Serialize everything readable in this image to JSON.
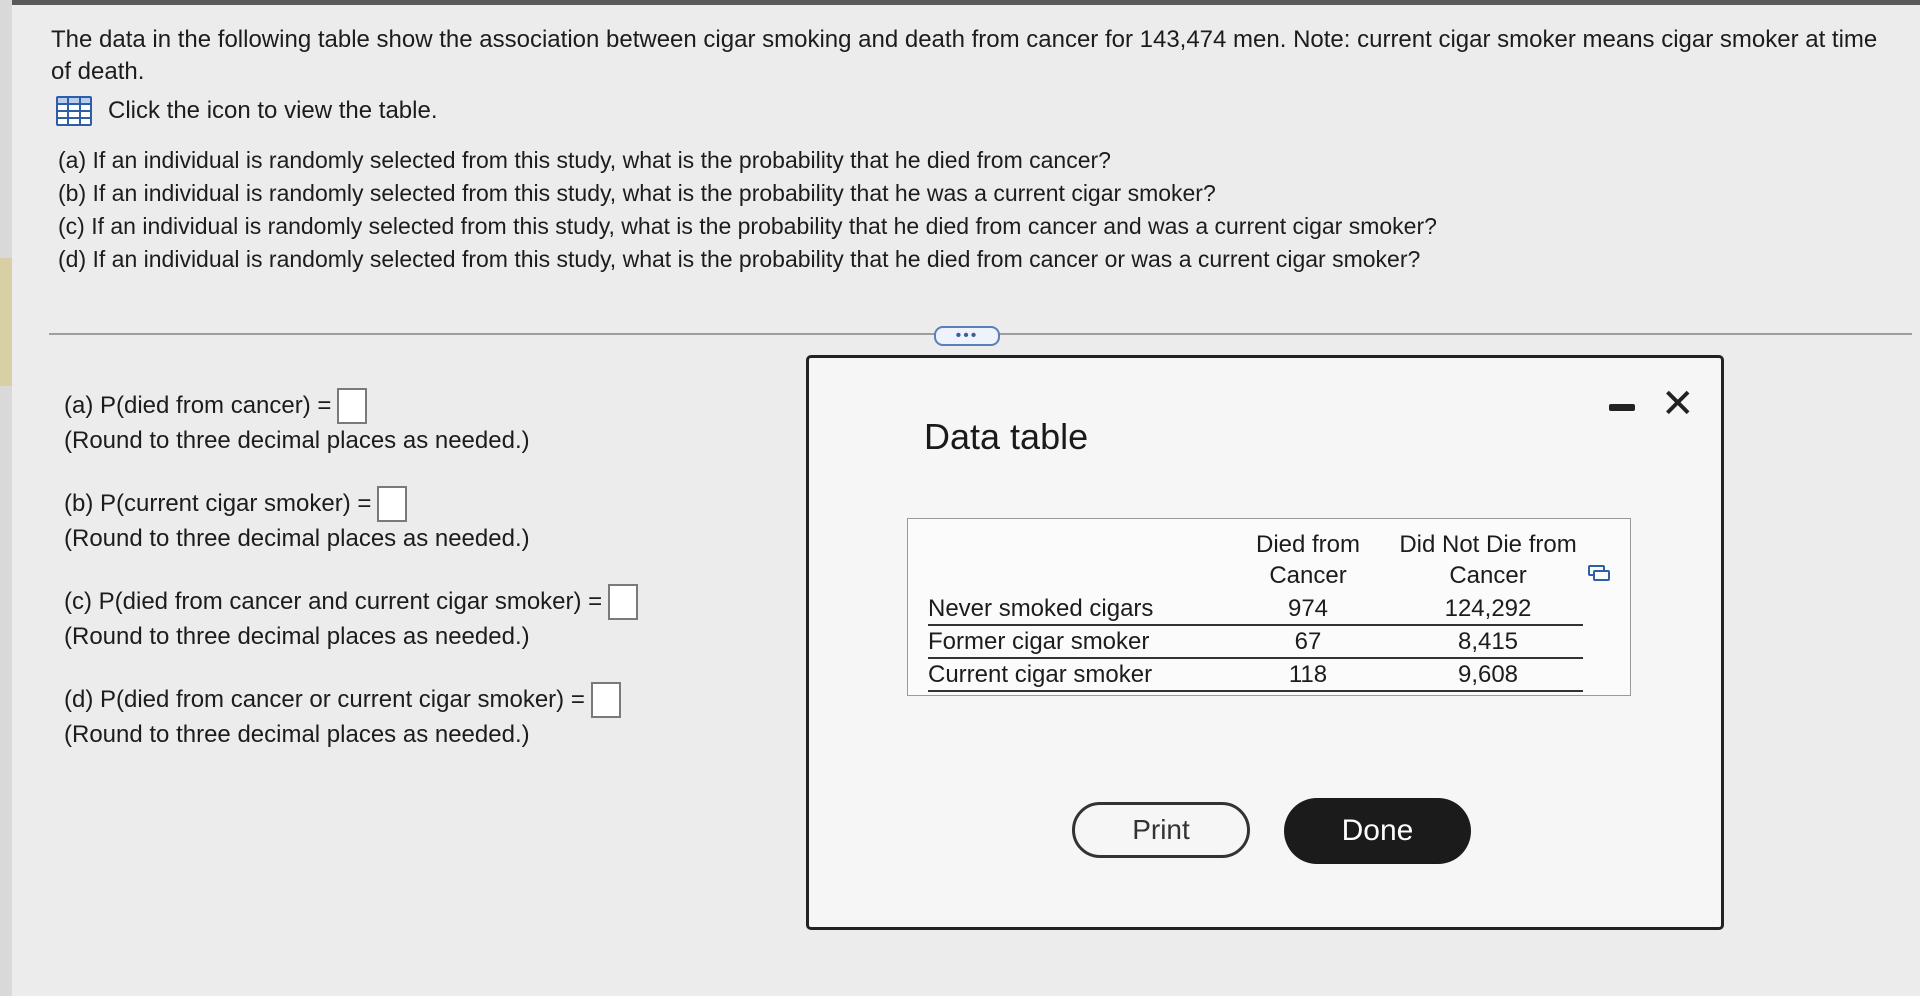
{
  "question": {
    "intro": "The data in the following table show the association between cigar smoking and death from cancer for 143,474 men. Note: current cigar smoker means cigar smoker at time of death.",
    "table_link": "Click the icon to view the table.",
    "parts": [
      "(a) If an individual is randomly selected from this study, what is the probability that he died from cancer?",
      "(b) If an individual is randomly selected from this study, what is the probability that he was a current cigar smoker?",
      "(c) If an individual is randomly selected from this study, what is the probability that he died from cancer and was a current cigar smoker?",
      "(d) If an individual is randomly selected from this study, what is the probability that he died from cancer or was a current cigar smoker?"
    ]
  },
  "divider": {
    "ellipsis": "•••"
  },
  "answers": [
    {
      "label": "(a) P(died from cancer) =",
      "value": "",
      "note": "(Round to three decimal places as needed.)"
    },
    {
      "label": "(b) P(current cigar smoker) =",
      "value": "",
      "note": "(Round to three decimal places as needed.)"
    },
    {
      "label": "(c) P(died from cancer and current cigar smoker) =",
      "value": "",
      "note": "(Round to three decimal places as needed.)"
    },
    {
      "label": "(d) P(died from cancer or current cigar smoker) =",
      "value": "",
      "note": "(Round to three decimal places as needed.)"
    }
  ],
  "dialog": {
    "title": "Data table",
    "table": {
      "col_headers": [
        "Died from Cancer",
        "Did Not Die from Cancer"
      ],
      "rows": [
        {
          "label": "Never smoked cigars",
          "values": [
            "974",
            "124,292"
          ]
        },
        {
          "label": "Former cigar smoker",
          "values": [
            "67",
            "8,415"
          ]
        },
        {
          "label": "Current cigar smoker",
          "values": [
            "118",
            "9,608"
          ]
        }
      ]
    },
    "print_label": "Print",
    "done_label": "Done"
  },
  "colors": {
    "accent_blue": "#2f5ea8",
    "done_button": "#1b1b1b"
  }
}
